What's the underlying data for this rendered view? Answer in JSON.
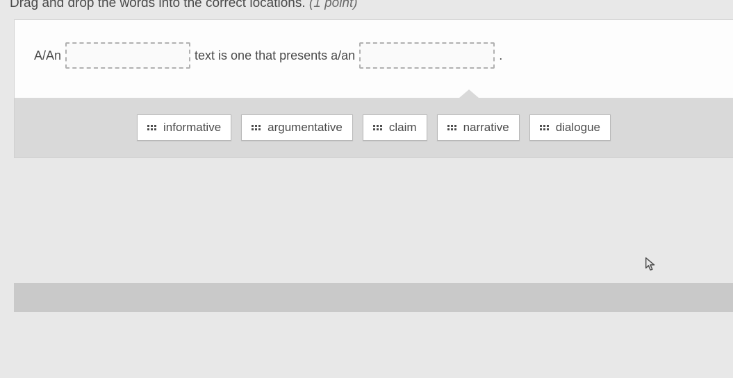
{
  "instruction": {
    "text": "Drag and drop the words into the correct locations.",
    "points": "(1 point)"
  },
  "sentence": {
    "part1": "A/An",
    "part2": "text is one that presents a/an",
    "after": "."
  },
  "options": [
    {
      "label": "informative"
    },
    {
      "label": "argumentative"
    },
    {
      "label": "claim"
    },
    {
      "label": "narrative"
    },
    {
      "label": "dialogue"
    }
  ]
}
